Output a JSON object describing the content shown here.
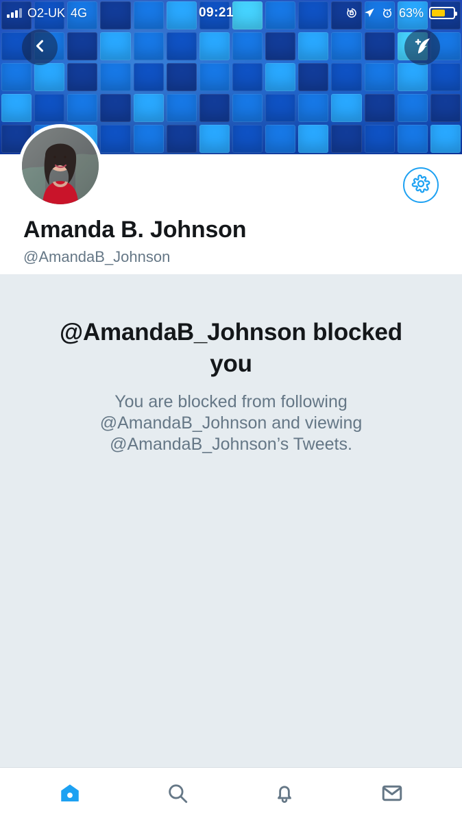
{
  "status_bar": {
    "carrier": "O2-UK",
    "network": "4G",
    "time": "09:21",
    "battery_percent": "63%",
    "battery_level": 0.63,
    "icons": [
      "signal-icon",
      "rotation-lock-icon",
      "location-arrow-icon",
      "alarm-clock-icon",
      "battery-icon"
    ]
  },
  "header": {
    "back_icon": "chevron-left-icon",
    "compose_icon": "compose-feather-icon"
  },
  "profile": {
    "name": "Amanda B. Johnson",
    "handle": "@AmandaB_Johnson",
    "settings_icon": "gear-icon"
  },
  "blocked": {
    "title_line_1": "@AmandaB_Johnson blocked",
    "title_line_2": "you",
    "message_line_1": "You are blocked from following",
    "message_line_2": "@AmandaB_Johnson and viewing",
    "message_line_3": "@AmandaB_Johnson’s Tweets."
  },
  "nav": {
    "home_icon": "home-icon",
    "search_icon": "search-icon",
    "notifications_icon": "bell-icon",
    "messages_icon": "mail-icon"
  },
  "colors": {
    "accent": "#1da1f2",
    "background": "#e6ecf0",
    "text_primary": "#14171a",
    "text_secondary": "#657786",
    "battery": "#ffcc00"
  }
}
